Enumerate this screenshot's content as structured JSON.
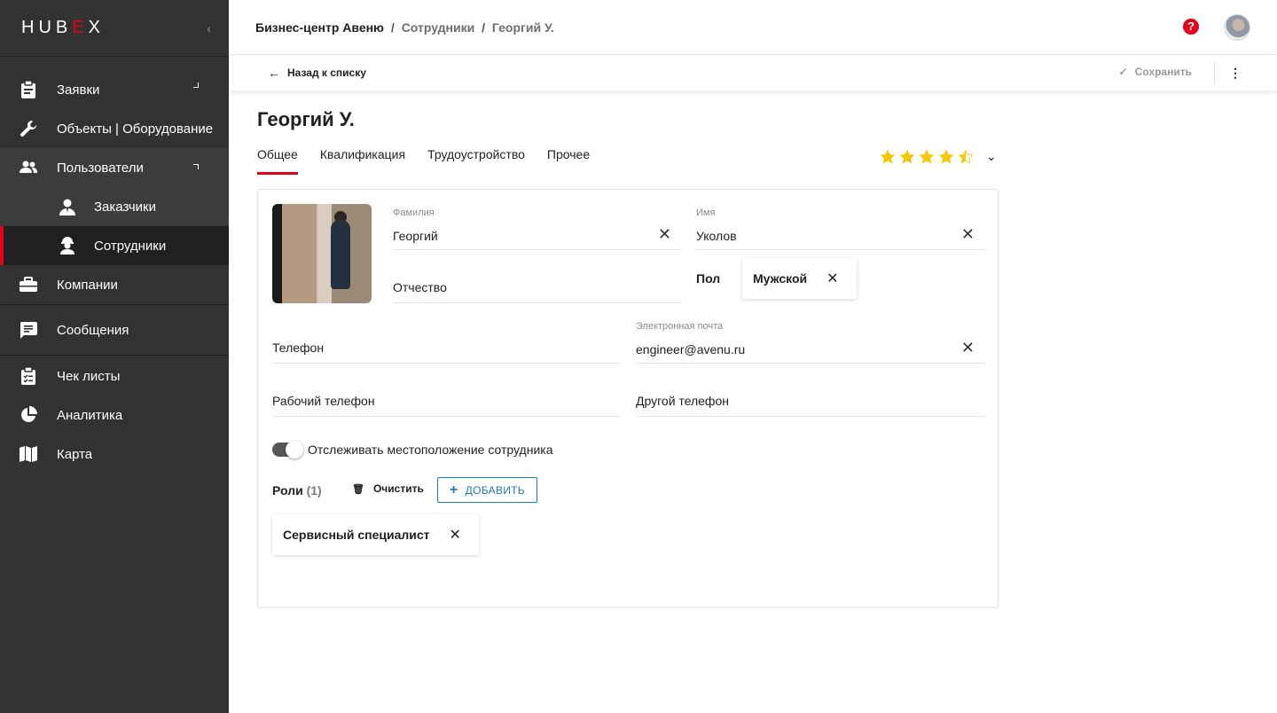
{
  "app": {
    "logo_text": "HUBEX",
    "brand_color": "#e3001b",
    "link_color": "#1f7bbf"
  },
  "sidebar": {
    "items": [
      {
        "label": "Заявки",
        "icon": "clipboard-icon"
      },
      {
        "label": "Объекты | Оборудование",
        "icon": "wrench-icon"
      },
      {
        "label": "Пользователи",
        "icon": "users-icon"
      },
      {
        "label": "Заказчики",
        "icon": "customer-icon"
      },
      {
        "label": "Сотрудники",
        "icon": "worker-icon"
      },
      {
        "label": "Компании",
        "icon": "briefcase-icon"
      },
      {
        "label": "Сообщения",
        "icon": "message-icon"
      },
      {
        "label": "Чек листы",
        "icon": "checklist-icon"
      },
      {
        "label": "Аналитика",
        "icon": "pie-chart-icon"
      },
      {
        "label": "Карта",
        "icon": "map-icon"
      }
    ]
  },
  "header": {
    "crumb_1": "Бизнес-центр Авеню",
    "sep": "/",
    "crumb_2": "Сотрудники",
    "crumb_3": "Георгий У."
  },
  "actions": {
    "back_label": "Назад к списку",
    "save_label": "Сохранить"
  },
  "page": {
    "title": "Георгий У.",
    "tabs": [
      "Общее",
      "Квалификация",
      "Трудоустройство",
      "Прочее"
    ],
    "rating": 4.5
  },
  "form": {
    "last_name": {
      "label": "Фамилия",
      "value": "Георгий"
    },
    "first_name": {
      "label": "Имя",
      "value": "Уколов"
    },
    "patronymic": {
      "placeholder": "Отчество"
    },
    "gender": {
      "label": "Пол",
      "value": "Мужской"
    },
    "phone": {
      "placeholder": "Телефон"
    },
    "email": {
      "label": "Электронная почта",
      "value": "engineer@avenu.ru"
    },
    "work_phone": {
      "placeholder": "Рабочий телефон"
    },
    "other_phone": {
      "placeholder": "Другой телефон"
    },
    "track_location": {
      "label": "Отслеживать местоположение сотрудника",
      "on": true
    },
    "roles": {
      "label": "Роли",
      "count": "(1)",
      "clear_label": "Очистить",
      "add_label": "ДОБАВИТЬ",
      "items": [
        "Сервисный специалист"
      ]
    }
  }
}
